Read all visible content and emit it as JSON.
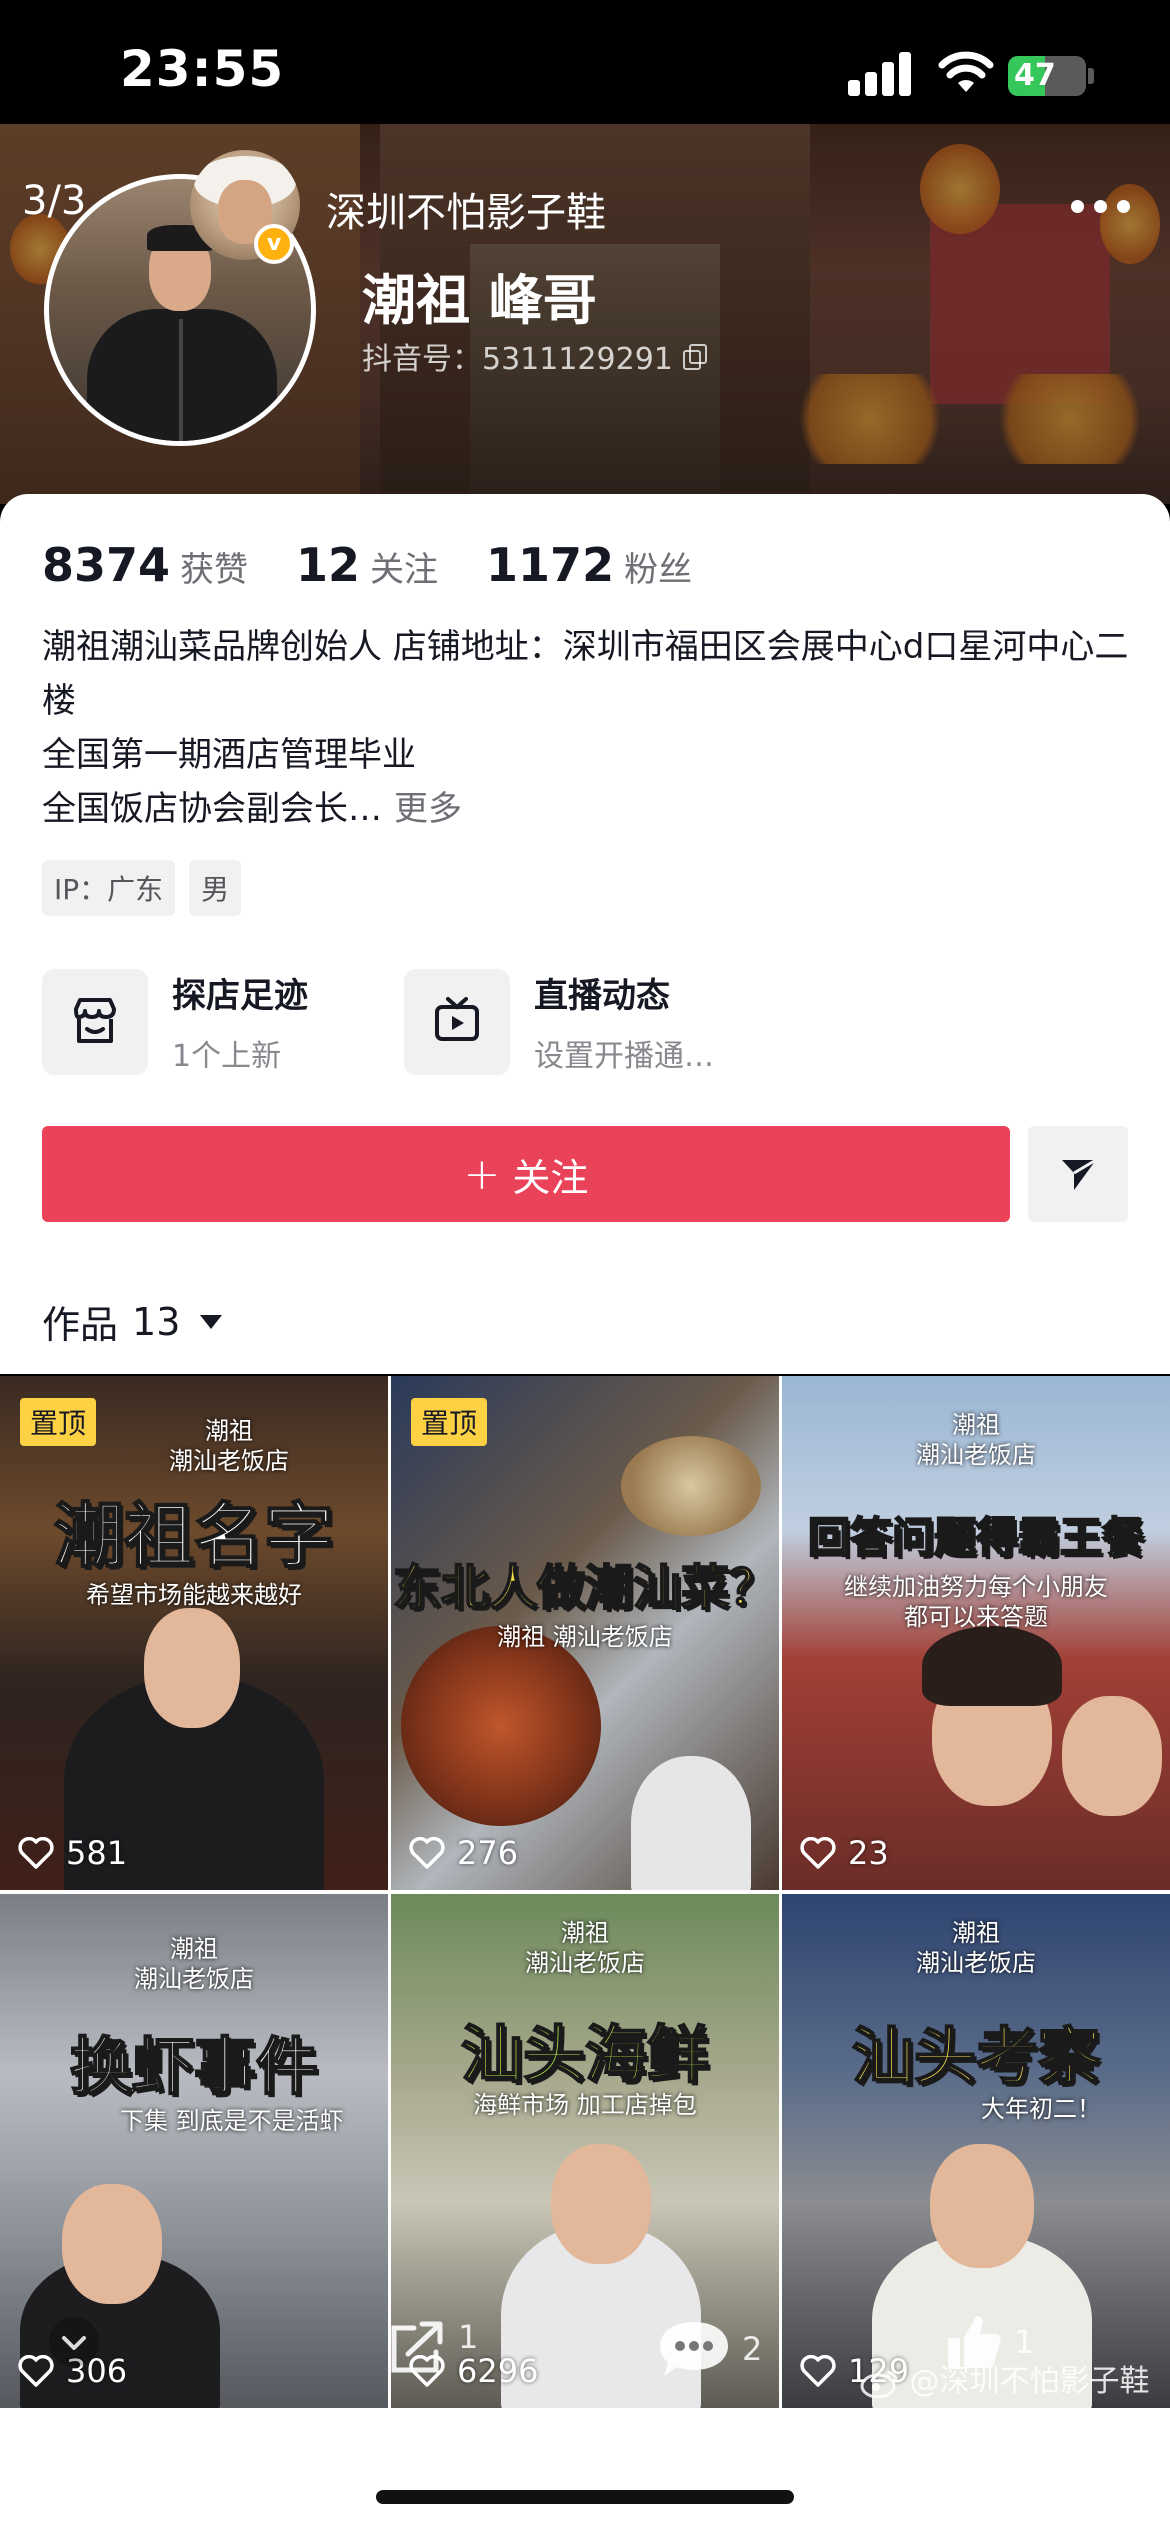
{
  "status_bar": {
    "time": "23:55",
    "battery_percent": "47",
    "battery_level": 0.47,
    "signal_bars": 4
  },
  "header": {
    "counter": "3/3",
    "nickname": "深圳不怕影子鞋",
    "display_name": "潮祖 峰哥",
    "douyin_id": "抖音号：5311129291"
  },
  "stats": [
    {
      "value": "8374",
      "label": "获赞"
    },
    {
      "value": "12",
      "label": "关注"
    },
    {
      "value": "1172",
      "label": "粉丝"
    }
  ],
  "bio": {
    "line1": "潮祖潮汕菜品牌创始人 店铺地址：深圳市福田区会展中心d口星河中心二楼",
    "line2": "全国第一期酒店管理毕业",
    "line3": "全国饭店协会副会长…",
    "more": "更多"
  },
  "tags": [
    "IP：广东",
    "男"
  ],
  "shortcuts": [
    {
      "title": "探店足迹",
      "subtitle": "1个上新",
      "icon": "shop-icon"
    },
    {
      "title": "直播动态",
      "subtitle": "设置开播通…",
      "icon": "tv-icon"
    }
  ],
  "follow_label": "关注",
  "works": {
    "label": "作品",
    "count": "13"
  },
  "videos": [
    {
      "pinned": "置顶",
      "shop": "潮祖\n潮汕老饭店",
      "headline": "潮祖名字",
      "sub": "希望市场能越来越好",
      "likes": "581"
    },
    {
      "pinned": "置顶",
      "shop": "潮祖 潮汕老饭店",
      "headline": "东北人做潮汕菜？",
      "sub": "",
      "likes": "276"
    },
    {
      "pinned": "",
      "shop": "潮祖\n潮汕老饭店",
      "headline": "回答问题得霸王餐",
      "sub": "继续加油努力每个小朋友\n都可以来答题",
      "likes": "23"
    },
    {
      "pinned": "",
      "shop": "潮祖\n潮汕老饭店",
      "headline": "换虾事件",
      "sub": "下集 到底是不是活虾",
      "likes": "306"
    },
    {
      "pinned": "",
      "shop": "潮祖\n潮汕老饭店",
      "headline": "汕头海鲜",
      "sub": "海鲜市场 加工店掉包",
      "likes": "6296"
    },
    {
      "pinned": "",
      "shop": "潮祖\n潮汕老饭店",
      "headline": "汕头考察",
      "sub": "大年初二！",
      "likes": "129"
    }
  ],
  "overlay": {
    "share_count": "1",
    "comment_count": "2",
    "like_count": "1",
    "watermark": "@深圳不怕影子鞋"
  },
  "colors": {
    "accent": "#ea4259",
    "pin": "#fcd144",
    "battery": "#35c759"
  }
}
